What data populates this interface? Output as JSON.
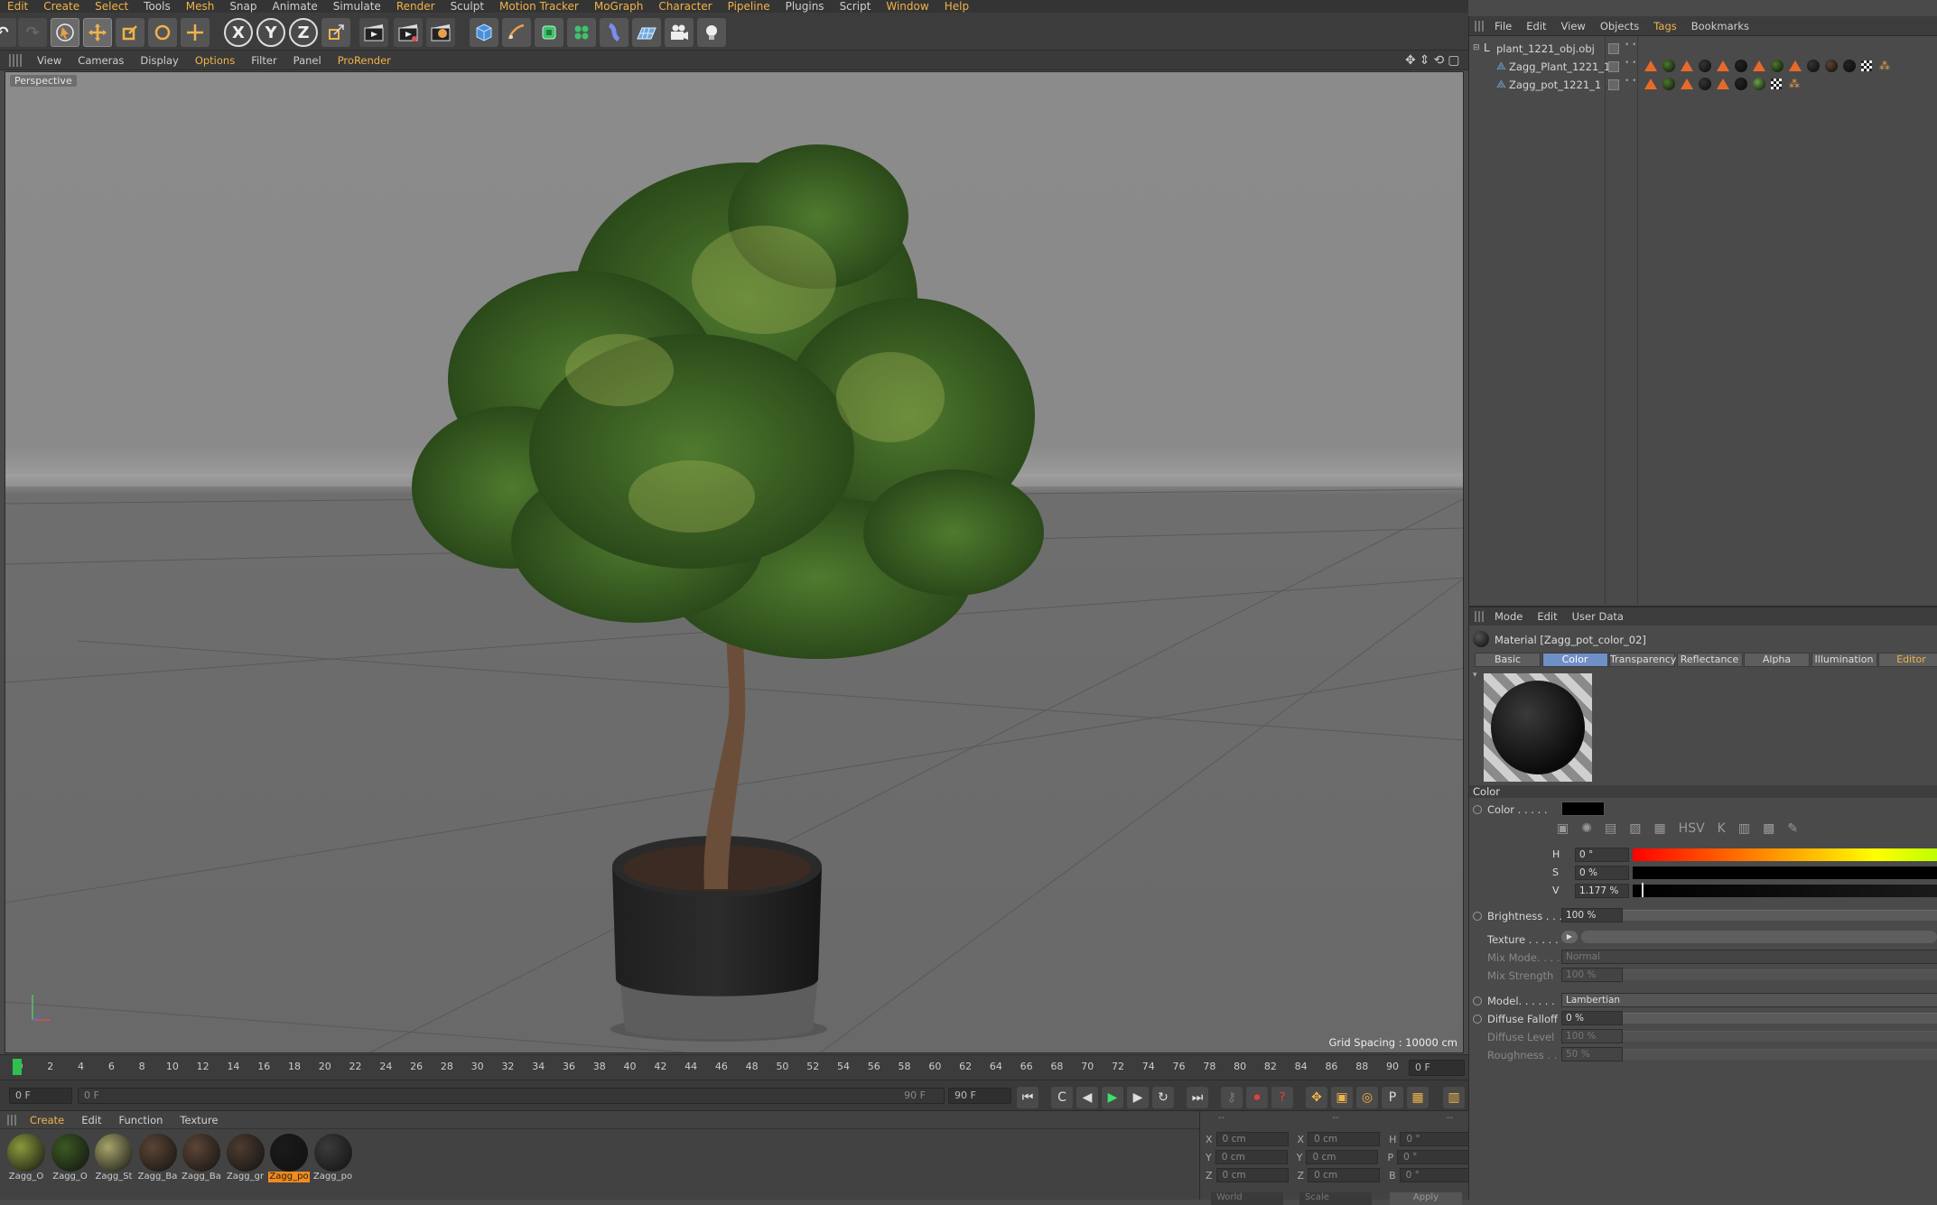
{
  "menubar": [
    "Edit",
    "Create",
    "Select",
    "Tools",
    "Mesh",
    "Snap",
    "Animate",
    "Simulate",
    "Render",
    "Sculpt",
    "Motion Tracker",
    "MoGraph",
    "Character",
    "Pipeline",
    "Plugins",
    "Script",
    "Window",
    "Help"
  ],
  "toolbar": {
    "icons": [
      "undo-icon",
      "redo-icon",
      "live-select-icon",
      "move-icon",
      "scale-icon",
      "rotate-icon",
      "axis-add-icon",
      "x-axis-icon",
      "y-axis-icon",
      "z-axis-icon",
      "coordinate-system-icon",
      "render-view-icon",
      "render-to-picture-viewer-icon",
      "render-settings-icon",
      "cube-icon",
      "pen-icon",
      "subdivision-icon",
      "cloner-icon",
      "deformer-icon",
      "floor-icon",
      "camera-icon",
      "light-icon"
    ],
    "axis_labels": [
      "X",
      "Y",
      "Z"
    ]
  },
  "viewport": {
    "menu": [
      "View",
      "Cameras",
      "Display",
      "Options",
      "Filter",
      "Panel",
      "ProRender"
    ],
    "label": "Perspective",
    "grid_spacing": "Grid Spacing : 10000 cm"
  },
  "timeline": {
    "ticks": [
      "0",
      "2",
      "4",
      "6",
      "8",
      "10",
      "12",
      "14",
      "16",
      "18",
      "20",
      "22",
      "24",
      "26",
      "28",
      "30",
      "32",
      "34",
      "36",
      "38",
      "40",
      "42",
      "44",
      "46",
      "48",
      "50",
      "52",
      "54",
      "56",
      "58",
      "60",
      "62",
      "64",
      "66",
      "68",
      "70",
      "72",
      "74",
      "76",
      "78",
      "80",
      "82",
      "84",
      "86",
      "88",
      "90"
    ],
    "current_frame": "0 F"
  },
  "playbar": {
    "start_field": "0 F",
    "range_start": "0 F",
    "range_end": "90 F",
    "end_field": "90 F"
  },
  "material_manager": {
    "menu": [
      "Create",
      "Edit",
      "Function",
      "Texture"
    ],
    "materials": [
      {
        "label": "Zagg_O",
        "color": "#8a9a3c"
      },
      {
        "label": "Zagg_O",
        "color": "#3b5a22"
      },
      {
        "label": "Zagg_St",
        "color": "#a7a46a"
      },
      {
        "label": "Zagg_Ba",
        "color": "#5b4535"
      },
      {
        "label": "Zagg_Ba",
        "color": "#5d4536"
      },
      {
        "label": "Zagg_gr",
        "color": "#4e3c2f"
      },
      {
        "label": "Zagg_po",
        "color": "#1a1a1a"
      },
      {
        "label": "Zagg_po",
        "color": "#3b3b3b"
      }
    ],
    "selected_index": 6
  },
  "coordinates": {
    "header": [
      "--",
      "--",
      "--"
    ],
    "rows": [
      {
        "a": "X",
        "av": "0 cm",
        "b": "X",
        "bv": "0 cm",
        "c": "H",
        "cv": "0 °"
      },
      {
        "a": "Y",
        "av": "0 cm",
        "b": "Y",
        "bv": "0 cm",
        "c": "P",
        "cv": "0 °"
      },
      {
        "a": "Z",
        "av": "0 cm",
        "b": "Z",
        "bv": "0 cm",
        "c": "B",
        "cv": "0 °"
      }
    ],
    "world": "World",
    "scale": "Scale",
    "apply": "Apply"
  },
  "object_manager": {
    "menu": [
      "File",
      "Edit",
      "View",
      "Objects",
      "Tags",
      "Bookmarks"
    ],
    "objects": [
      {
        "name": "plant_1221_obj.obj",
        "indent": 0
      },
      {
        "name": "Zagg_Plant_1221_1",
        "indent": 1
      },
      {
        "name": "Zagg_pot_1221_1",
        "indent": 1
      }
    ]
  },
  "attribute_manager": {
    "menu": [
      "Mode",
      "Edit",
      "User Data"
    ],
    "title": "Material [Zagg_pot_color_02]",
    "tabs": [
      "Basic",
      "Color",
      "Transparency",
      "Reflectance",
      "Alpha",
      "Illumination",
      "Editor"
    ],
    "active_tab": "Color",
    "section": "Color",
    "color_label": "Color . . . . .",
    "color_swatch": "#000000",
    "hsv": [
      {
        "label": "H",
        "value": "0 °"
      },
      {
        "label": "S",
        "value": "0 %"
      },
      {
        "label": "V",
        "value": "1.177 %"
      }
    ],
    "brightness": {
      "label": "Brightness . . .",
      "value": "100 %"
    },
    "texture_label": "Texture . . . . .",
    "mix_mode": {
      "label": "Mix Mode. . . .",
      "value": "Normal"
    },
    "mix_strength": {
      "label": "Mix Strength",
      "value": "100 %"
    },
    "model": {
      "label": "Model. . . . . .",
      "value": "Lambertian"
    },
    "diffuse_falloff": {
      "label": "Diffuse Falloff",
      "value": "0 %"
    },
    "diffuse_level": {
      "label": "Diffuse Level",
      "value": "100 %"
    },
    "roughness": {
      "label": "Roughness . .",
      "value": "50 %"
    }
  }
}
